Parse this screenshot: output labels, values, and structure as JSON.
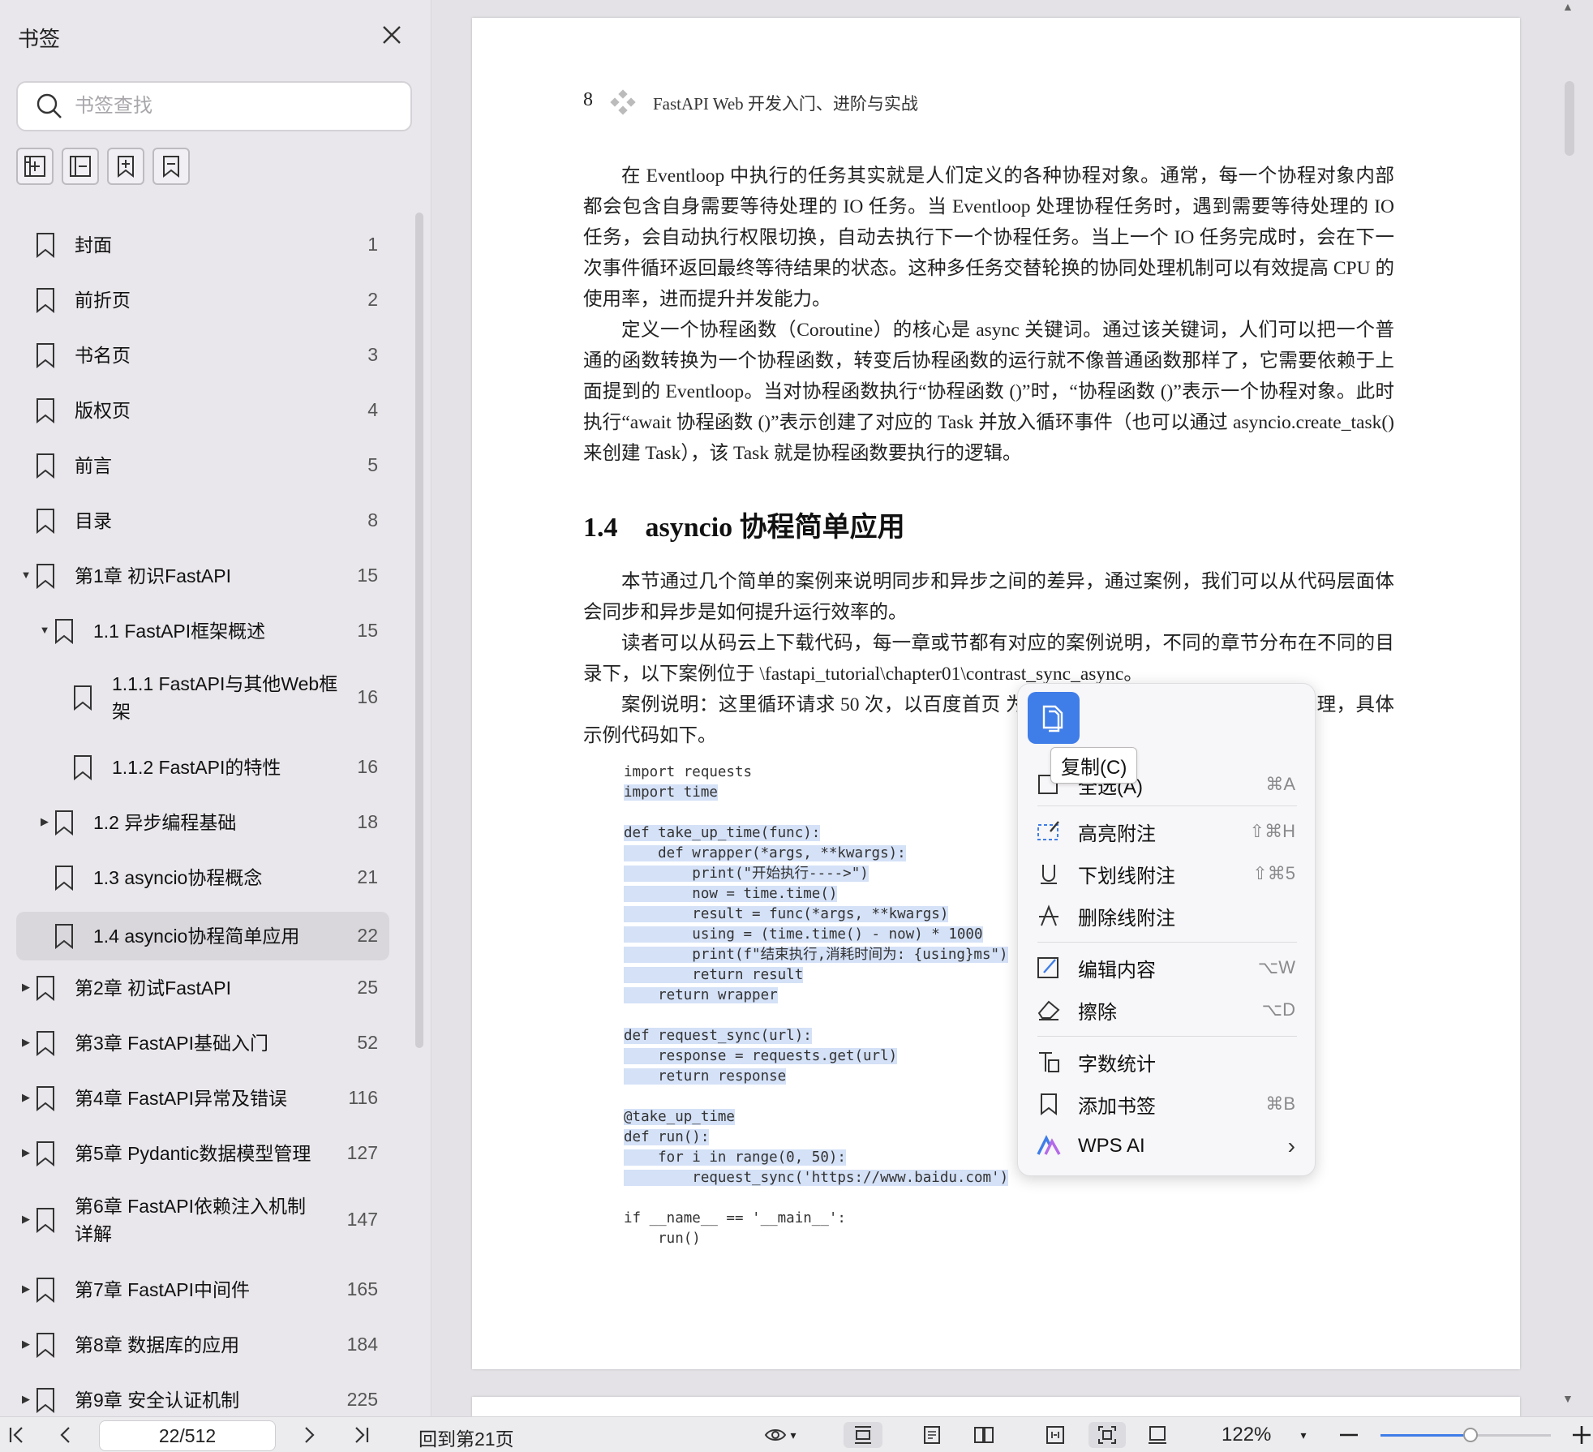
{
  "sidebar": {
    "title": "书签",
    "search_placeholder": "书签查找",
    "items": [
      {
        "label": "封面",
        "page": "1"
      },
      {
        "label": "前折页",
        "page": "2"
      },
      {
        "label": "书名页",
        "page": "3"
      },
      {
        "label": "版权页",
        "page": "4"
      },
      {
        "label": "前言",
        "page": "5"
      },
      {
        "label": "目录",
        "page": "8"
      },
      {
        "label": "第1章 初识FastAPI",
        "page": "15",
        "expand": "open"
      },
      {
        "label": "1.1 FastAPI框架概述",
        "page": "15",
        "expand": "open"
      },
      {
        "label": "1.1.1 FastAPI与其他Web框",
        "label2": "架",
        "page": "16"
      },
      {
        "label": "1.1.2 FastAPI的特性",
        "page": "16"
      },
      {
        "label": "1.2 异步编程基础",
        "page": "18",
        "expand": "closed"
      },
      {
        "label": "1.3 asyncio协程概念",
        "page": "21"
      },
      {
        "label": "1.4 asyncio协程简单应用",
        "page": "22",
        "selected": true
      },
      {
        "label": "第2章 初试FastAPI",
        "page": "25",
        "expand": "closed"
      },
      {
        "label": "第3章 FastAPI基础入门",
        "page": "52",
        "expand": "closed"
      },
      {
        "label": "第4章 FastAPI异常及错误",
        "page": "116",
        "expand": "closed"
      },
      {
        "label": "第5章 Pydantic数据模型管理",
        "page": "127",
        "expand": "closed"
      },
      {
        "label": "第6章 FastAPI依赖注入机制",
        "label2": "详解",
        "page": "147",
        "expand": "closed"
      },
      {
        "label": "第7章 FastAPI中间件",
        "page": "165",
        "expand": "closed"
      },
      {
        "label": "第8章 数据库的应用",
        "page": "184",
        "expand": "closed"
      },
      {
        "label": "第9章 安全认证机制",
        "page": "225",
        "expand": "closed"
      }
    ]
  },
  "page": {
    "header_number": "8",
    "header_title": "FastAPI Web 开发入门、进阶与实战",
    "p1": "在 Eventloop 中执行的任务其实就是人们定义的各种协程对象。通常，每一个协程对象内部都会包含自身需要等待处理的 IO 任务。当 Eventloop 处理协程任务时，遇到需要等待处理的 IO 任务，会自动执行权限切换，自动去执行下一个协程任务。当上一个 IO 任务完成时，会在下一次事件循环返回最终等待结果的状态。这种多任务交替轮换的协同处理机制可以有效提高 CPU 的使用率，进而提升并发能力。",
    "p2": "定义一个协程函数（Coroutine）的核心是 async 关键词。通过该关键词，人们可以把一个普通的函数转换为一个协程函数，转变后协程函数的运行就不像普通函数那样了，它需要依赖于上面提到的 Eventloop。当对协程函数执行“协程函数 ()”时，“协程函数 ()”表示一个协程对象。此时执行“await 协程函数 ()”表示创建了对应的 Task 并放入循环事件（也可以通过 asyncio.create_task() 来创建 Task），该 Task 就是协程函数要执行的逻辑。",
    "section_heading": "1.4　asyncio 协程简单应用",
    "p3": "本节通过几个简单的案例来说明同步和异步之间的差异，通过案例，我们可以从代码层面体会同步和异步是如何提升运行效率的。",
    "p4": "读者可以从码云上下载代码，每一章或节都有对应的案例说明，不同的章节分布在不同的目录下，以下案例位于 \\fastapi_tutorial\\chapter01\\contrast_sync_async。",
    "p5": "案例说明：这里循环请求 50 次，以百度首页 为目标，使用同步代码的方式请求处理，具体示例代码如下。",
    "code_lines": [
      "import requests",
      "import time",
      "",
      "def take_up_time(func):",
      "    def wrapper(*args, **kwargs):",
      "        print(\"开始执行---->\")",
      "        now = time.time()",
      "        result = func(*args, **kwargs)",
      "        using = (time.time() - now) * 1000",
      "        print(f\"结束执行,消耗时间为: {using}ms\")",
      "        return result",
      "    return wrapper",
      "",
      "def request_sync(url):",
      "    response = requests.get(url)",
      "    return response",
      "",
      "@take_up_time",
      "def run():",
      "    for i in range(0, 50):",
      "        request_sync('https://www.baidu.com')",
      "",
      "if __name__ == '__main__':",
      "    run()"
    ]
  },
  "context_menu": {
    "tooltip": "复制(C)",
    "items": [
      {
        "icon": "select-all-icon",
        "label": "全选(A)",
        "shortcut": "⌘A"
      },
      {
        "icon": "highlight-icon",
        "label": "高亮附注",
        "shortcut": "⇧⌘H"
      },
      {
        "icon": "underline-icon",
        "label": "下划线附注",
        "shortcut": "⇧⌘5"
      },
      {
        "icon": "strikethrough-icon",
        "label": "删除线附注",
        "shortcut": ""
      },
      {
        "icon": "edit-content-icon",
        "label": "编辑内容",
        "shortcut": "⌥W"
      },
      {
        "icon": "eraser-icon",
        "label": "擦除",
        "shortcut": "⌥D"
      },
      {
        "icon": "word-count-icon",
        "label": "字数统计",
        "shortcut": ""
      },
      {
        "icon": "bookmark-icon",
        "label": "添加书签",
        "shortcut": "⌘B"
      },
      {
        "icon": "wps-ai-icon",
        "label": "WPS AI",
        "shortcut": "›"
      }
    ]
  },
  "bottom_bar": {
    "page_value": "22/512",
    "back_label": "回到第21页",
    "zoom": "122%",
    "zoom_fraction": 0.53
  },
  "colors": {
    "accent": "#3f7de8",
    "selection": "#d4e1f7"
  }
}
